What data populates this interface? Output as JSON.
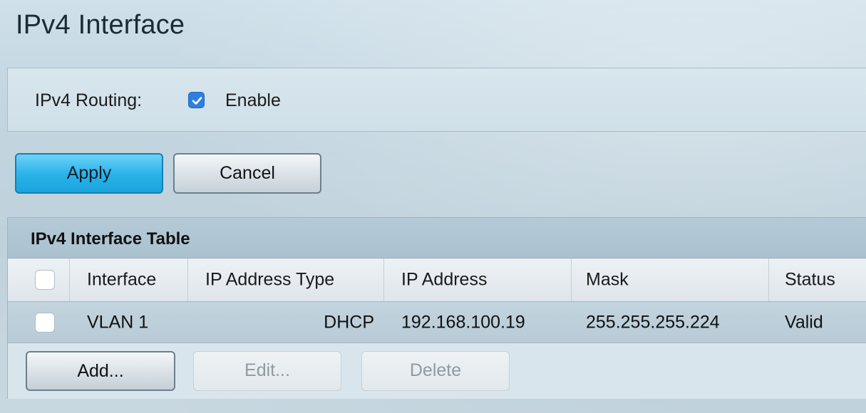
{
  "page": {
    "title": "IPv4 Interface"
  },
  "routing": {
    "label": "IPv4 Routing:",
    "enable_label": "Enable",
    "enabled": true
  },
  "actions": {
    "apply_label": "Apply",
    "cancel_label": "Cancel"
  },
  "table": {
    "caption": "IPv4 Interface Table",
    "columns": [
      "Interface",
      "IP Address Type",
      "IP Address",
      "Mask",
      "Status"
    ],
    "rows": [
      {
        "selected": false,
        "interface": "VLAN 1",
        "ip_address_type": "DHCP",
        "ip_address": "192.168.100.19",
        "mask": "255.255.255.224",
        "status": "Valid"
      }
    ],
    "buttons": {
      "add_label": "Add...",
      "edit_label": "Edit...",
      "delete_label": "Delete"
    }
  },
  "colors": {
    "primary_button": "#2bb4ea",
    "checkbox_checked": "#2f7fe0",
    "caption_bar": "#aac1cf"
  },
  "icons": {
    "routing_checkbox": "checkmark-icon"
  }
}
